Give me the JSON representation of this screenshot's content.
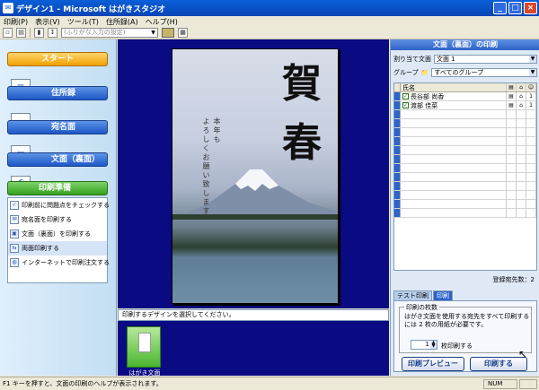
{
  "window": {
    "title": "デザイン1 - Microsoft はがきスタジオ",
    "app_icon": "postcard-app-icon",
    "minimize": "_",
    "maximize": "□",
    "close": "×"
  },
  "menu": [
    "印刷(P)",
    "表示(V)",
    "ツール(T)",
    "住所録(A)",
    "ヘルプ(H)"
  ],
  "toolbar": {
    "font_placeholder": "(ふりがな入力の設定)"
  },
  "left": {
    "start": "スタート",
    "address_book": "住所録",
    "address_side": "宛名面",
    "design_side": "文面（裏面）",
    "print_prep": "印刷準備",
    "tasks": [
      "印刷前に問題点をチェックする",
      "宛名面を印刷する",
      "文面（裏面）を印刷する",
      "両面印刷する",
      "インターネットで印刷注文する"
    ]
  },
  "card": {
    "kanji1": "賀",
    "kanji2": "春",
    "greeting_line1": "本年も",
    "greeting_line2": "よろしくお願い致します"
  },
  "status_strip": "印刷するデザインを選択してください。",
  "thumbnail": {
    "label": "はがき文面"
  },
  "right": {
    "title": "文面（裏面）の印刷",
    "assign_label": "割り当て文面",
    "assign_value": "文面 1",
    "group_label": "グループ",
    "group_value": "すべてのグループ",
    "col_name": "氏名",
    "contacts": [
      {
        "name": "長谷部 尚香"
      },
      {
        "name": "渡部 佳菜"
      }
    ],
    "registered": "登録宛先数：2",
    "tabs": [
      "テスト印刷",
      "印刷"
    ],
    "copies_legend": "印刷の枚数",
    "copies_desc": "はがき文面を使用する宛先をすべて印刷するには 2 枚の用紙が必要です。",
    "copies_value": "1",
    "copies_unit": "枚印刷する",
    "preview_btn": "印刷プレビュー",
    "print_btn": "印刷する"
  },
  "statusbar": {
    "text": "F1 キーを押すと、文面の印刷のヘルプが表示されます。",
    "num": "NUM"
  }
}
